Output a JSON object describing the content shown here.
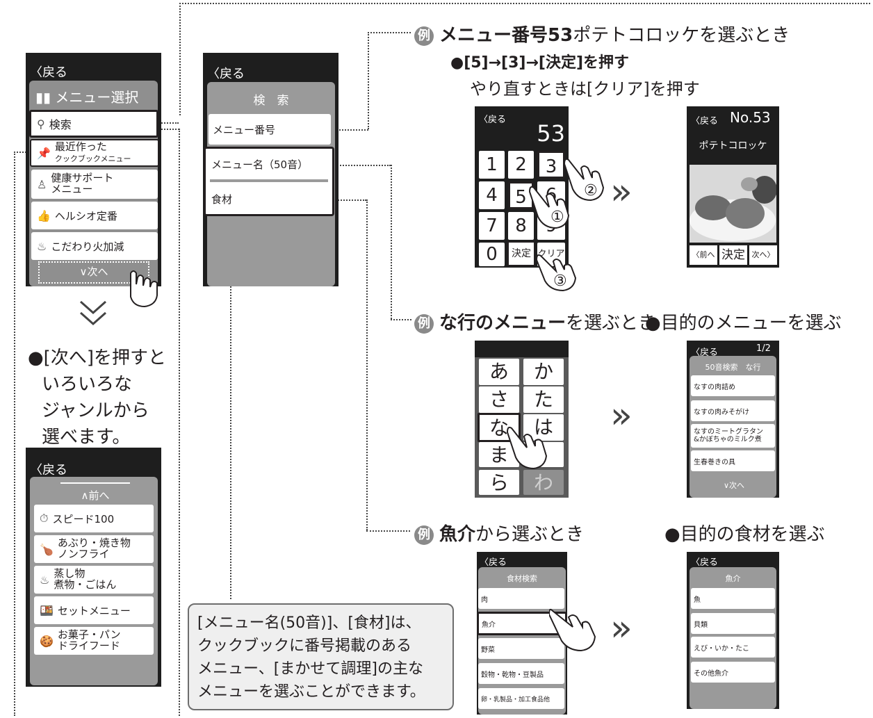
{
  "back_label": "〈戻る",
  "menu_screen": {
    "title": "メニュー選択",
    "items": [
      {
        "icon": "search-icon",
        "label": "検索"
      },
      {
        "icon": "pin-icon",
        "label": "最近作った",
        "sub": "クックブックメニュー"
      },
      {
        "icon": "person-icon",
        "label": "健康サポート",
        "sub": "メニュー"
      },
      {
        "icon": "thumbs-up-icon",
        "label": "ヘルシオ定番"
      },
      {
        "icon": "flame-icon",
        "label": "こだわり火加減"
      }
    ],
    "next": "∨次へ"
  },
  "search_screen": {
    "title": "検　索",
    "items": [
      "メニュー番号",
      "メニュー名（50音）",
      "食材"
    ]
  },
  "note_next": [
    "●[次へ]を押すと",
    "いろいろな",
    "ジャンルから",
    "選べます。"
  ],
  "genre_screen": {
    "prev": "∧前へ",
    "items": [
      {
        "icon": "timer-icon",
        "label": "スピード100"
      },
      {
        "icon": "roast-icon",
        "label": "あぶり・焼き物",
        "sub": "ノンフライ"
      },
      {
        "icon": "steam-icon",
        "label": "蒸し物",
        "sub": "煮物・ごはん"
      },
      {
        "icon": "set-icon",
        "label": "セットメニュー"
      },
      {
        "icon": "sweets-icon",
        "label": "お菓子・パン",
        "sub": "ドライフード"
      }
    ]
  },
  "example1": {
    "badge": "例",
    "heading_bold": "メニュー番号53",
    "heading_rest": "ポテトコロッケを選ぶとき",
    "step": "●[5]→[3]→[決定]を押す",
    "redo": "やり直すときは[クリア]を押す",
    "display": "53",
    "keys": [
      "1",
      "2",
      "3",
      "4",
      "5",
      "6",
      "7",
      "8",
      "9",
      "0",
      "決定",
      "クリア"
    ],
    "marks": [
      "①",
      "②",
      "③"
    ],
    "result_no": "No.53",
    "result_title": "ポテトコロッケ",
    "result_buttons": [
      "〈前へ",
      "決定",
      "次へ〉"
    ]
  },
  "example2": {
    "badge": "例",
    "heading_bold": "な行のメニュー",
    "heading_rest": "を選ぶとき",
    "right_heading": "●目的のメニューを選ぶ",
    "kana": [
      "あ",
      "か",
      "さ",
      "た",
      "な",
      "は",
      "ま",
      "",
      "ら",
      "わ"
    ],
    "page": "1/2",
    "list_title": "50音検索　な行",
    "list_items": [
      "なすの肉詰め",
      "なすの肉みそがけ",
      "なすのミートグラタン",
      "&かぼちゃのミルク煮",
      "生春巻きの具"
    ],
    "next": "∨次へ"
  },
  "example3": {
    "badge": "例",
    "heading_bold": "魚介",
    "heading_rest": "から選ぶとき",
    "right_heading": "●目的の食材を選ぶ",
    "left_title": "食材検索",
    "left_items": [
      "肉",
      "魚介",
      "野菜",
      "穀物・乾物・豆製品",
      "卵・乳製品・加工食品他"
    ],
    "right_title": "魚介",
    "right_items": [
      "魚",
      "貝類",
      "えび・いか・たこ",
      "その他魚介"
    ]
  },
  "note_box": [
    "[メニュー名(50音)]、[食材]は、",
    "クックブックに番号掲載のある",
    "メニュー、[まかせて調理]の主な",
    "メニューを選ぶことができます。"
  ]
}
